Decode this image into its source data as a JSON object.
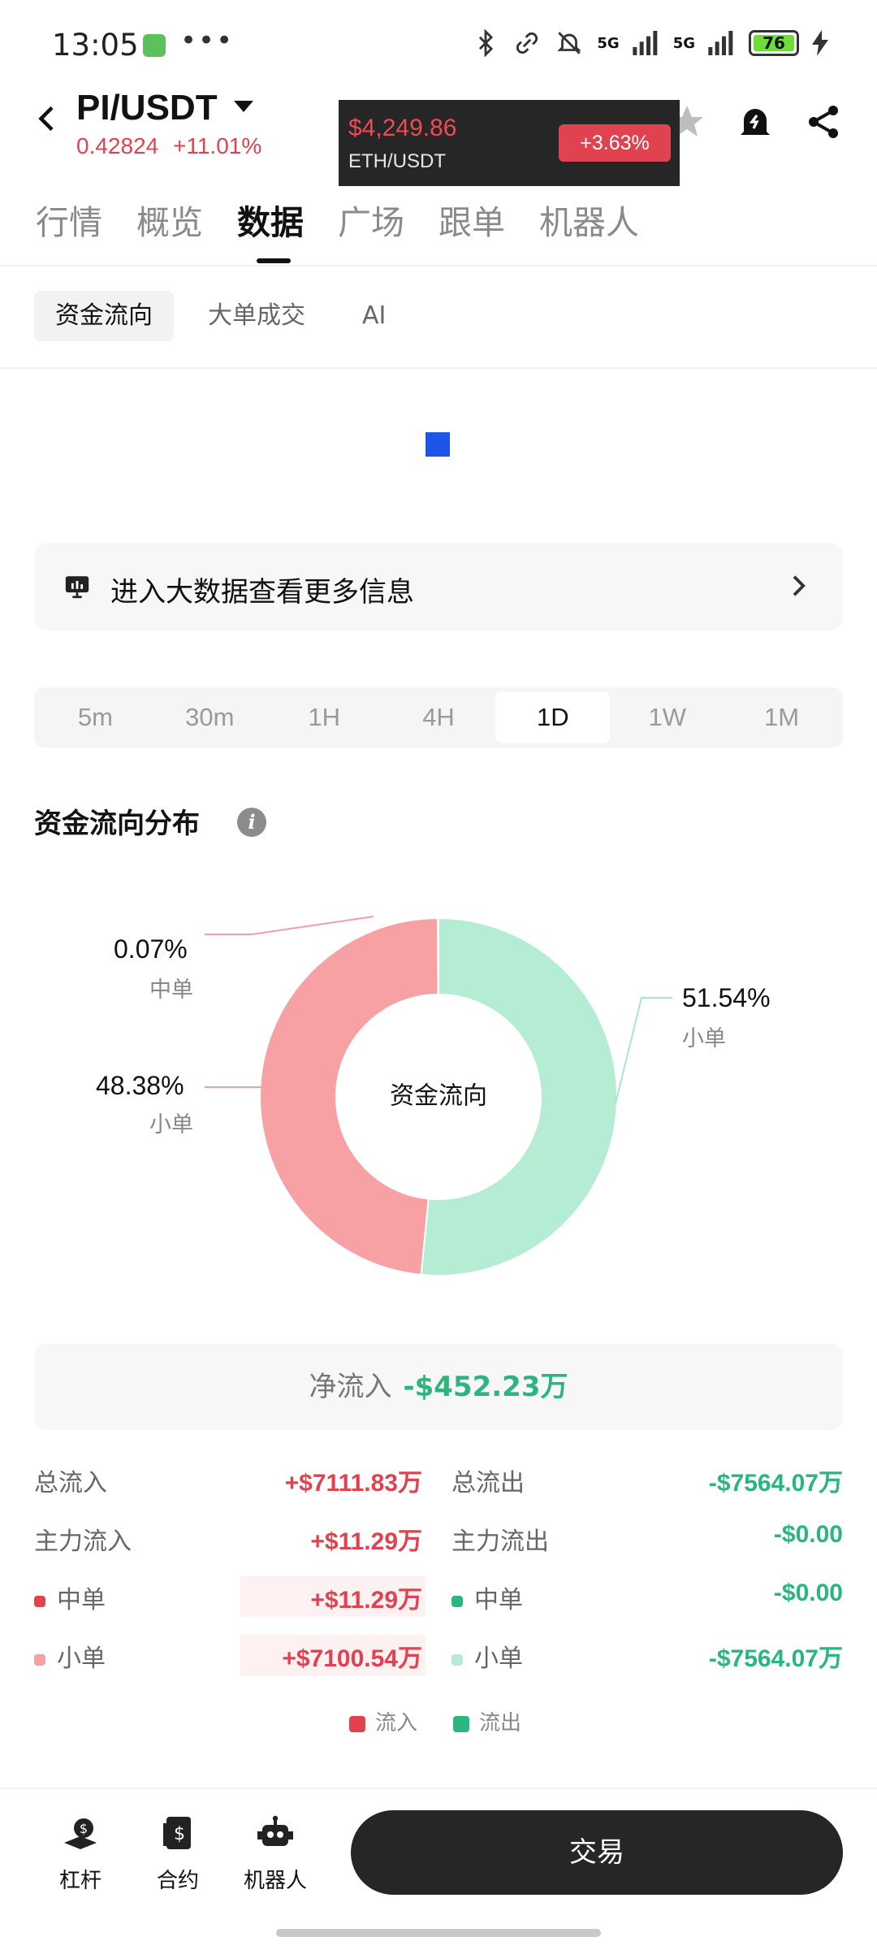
{
  "status": {
    "time": "13:05",
    "dots": "•••",
    "battery": "76",
    "net1": "5G",
    "net2": "5G"
  },
  "header": {
    "pair": "PI/USDT",
    "price": "0.42824",
    "change": "+11.01%",
    "ticker": {
      "price": "$4,249.86",
      "pair": "ETH/USDT",
      "change": "+3.63%"
    }
  },
  "tabs": [
    "行情",
    "概览",
    "数据",
    "广场",
    "跟单",
    "机器人"
  ],
  "subtabs": [
    "资金流向",
    "大单成交",
    "AI"
  ],
  "banner": {
    "text": "进入大数据查看更多信息"
  },
  "timeframes": [
    "5m",
    "30m",
    "1H",
    "4H",
    "1D",
    "1W",
    "1M"
  ],
  "active_timeframe": "1D",
  "section": {
    "title": "资金流向分布",
    "info": "i"
  },
  "donut": {
    "center": "资金流向",
    "labels": [
      {
        "pct": "0.07%",
        "name": "中单"
      },
      {
        "pct": "48.38%",
        "name": "小单"
      },
      {
        "pct": "51.54%",
        "name": "小单"
      }
    ]
  },
  "chart_data": {
    "type": "pie",
    "title": "资金流向",
    "series": [
      {
        "name": "中单",
        "value": 0.07,
        "color": "#e0424f"
      },
      {
        "name": "小单",
        "value": 48.38,
        "color": "#f7a1a5"
      },
      {
        "name": "小单",
        "value": 51.54,
        "color": "#b4ecd4"
      }
    ]
  },
  "net": {
    "label": "净流入",
    "value": "-$452.23万"
  },
  "rows": {
    "total_in_label": "总流入",
    "total_in": "+$7111.83万",
    "total_out_label": "总流出",
    "total_out": "-$7564.07万",
    "main_in_label": "主力流入",
    "main_in": "+$11.29万",
    "main_out_label": "主力流出",
    "main_out": "-$0.00",
    "mid_in_label": "中单",
    "mid_in": "+$11.29万",
    "mid_out_label": "中单",
    "mid_out": "-$0.00",
    "small_in_label": "小单",
    "small_in": "+$7100.54万",
    "small_out_label": "小单",
    "small_out": "-$7564.07万"
  },
  "legend": {
    "in": "流入",
    "out": "流出"
  },
  "colors": {
    "inflow": "#e0424f",
    "outflow": "#2bb57f",
    "loader": "#1e55e6"
  },
  "bottom": {
    "items": [
      "杠杆",
      "合约",
      "机器人"
    ],
    "trade": "交易"
  }
}
